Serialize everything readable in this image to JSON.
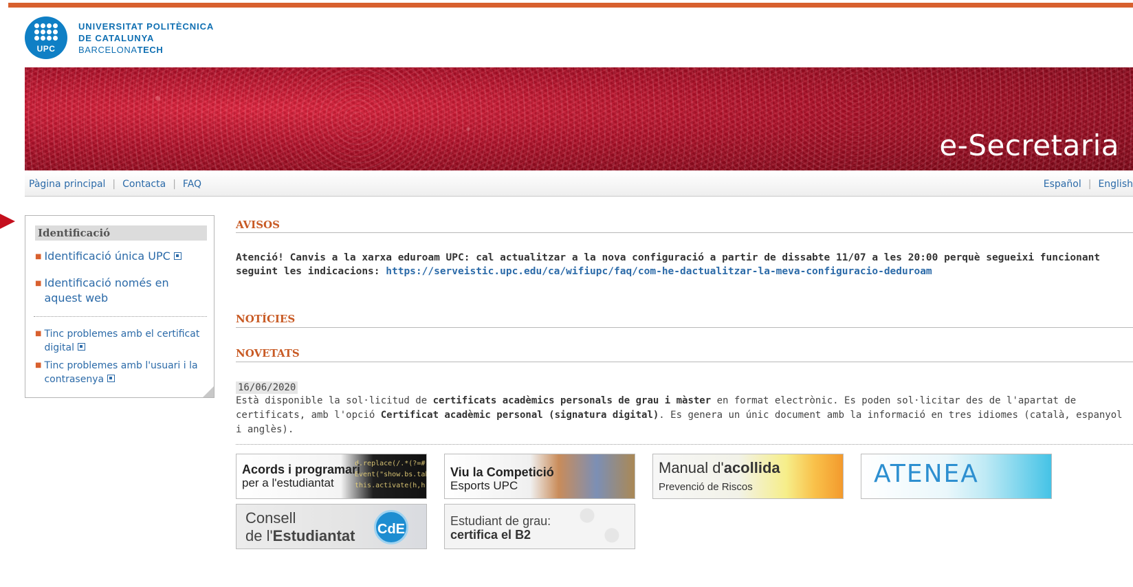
{
  "logo": {
    "line1": "UNIVERSITAT POLITÈCNICA",
    "line2": "DE CATALUNYA",
    "line3a": "BARCELONA",
    "line3b": "TECH",
    "badge": "UPC"
  },
  "banner": {
    "title": "e-Secretaria"
  },
  "nav": {
    "left": [
      "Pàgina principal",
      "Contacta",
      "FAQ"
    ],
    "right": [
      "Español",
      "English"
    ]
  },
  "sidebar": {
    "title": "Identificació",
    "links": [
      "Identificació única UPC",
      "Identificació només en aquest web",
      "Tinc problemes amb el certificat digital",
      "Tinc problemes amb l'usuari i la contrasenya"
    ]
  },
  "avisos": {
    "title": "AVISOS",
    "text": "Atenció! Canvis a la xarxa eduroam UPC: cal actualitzar a la nova configuració a partir de dissabte 11/07 a les 20:00 perquè segueixi funcionant seguint les indicacions: ",
    "link": "https://serveistic.upc.edu/ca/wifiupc/faq/com-he-dactualitzar-la-meva-configuracio-deduroam"
  },
  "noticies": {
    "title": "NOTÍCIES"
  },
  "novetats": {
    "title": "NOVETATS",
    "date": "16/06/2020",
    "p1": "Està disponible la sol·licitud de ",
    "b1": "certificats acadèmics personals de grau i màster",
    "p2": " en format electrònic. Es poden sol·licitar des de l'apartat de certificats, amb l'opció ",
    "b2": "Certificat acadèmic personal (signatura digital)",
    "p3": ". Es genera un únic document amb la informació en tres idiomes (català, espanyol i anglès)."
  },
  "tiles": {
    "acords": {
      "line1": "Acords i programari",
      "line2": "per a l'estudiantat",
      "code": "d.replace(/.*(?=#[^\\s]\nEvent(\"show.bs.tab\",{relatedT\nthis.activate(h,h.paren"
    },
    "viu": {
      "line1": "Viu la Competició",
      "line2": "Esports UPC"
    },
    "manual": {
      "line1a": "Manual d'",
      "line1b": "acollida",
      "line2": "Prevenció de Riscos"
    },
    "atenea": {
      "label": "ATENEA"
    },
    "consell": {
      "line1": "Consell",
      "line2a": "de l'",
      "line2b": "Estudiantat",
      "badge": "CdE"
    },
    "b2": {
      "line1": "Estudiant de grau:",
      "line2a": "certifica el ",
      "line2b": "B2"
    }
  },
  "colors": {
    "accent": "#d8602e",
    "link": "#2b6aa8",
    "upc_blue": "#0f7fc5",
    "arrow": "#c40f1d"
  }
}
